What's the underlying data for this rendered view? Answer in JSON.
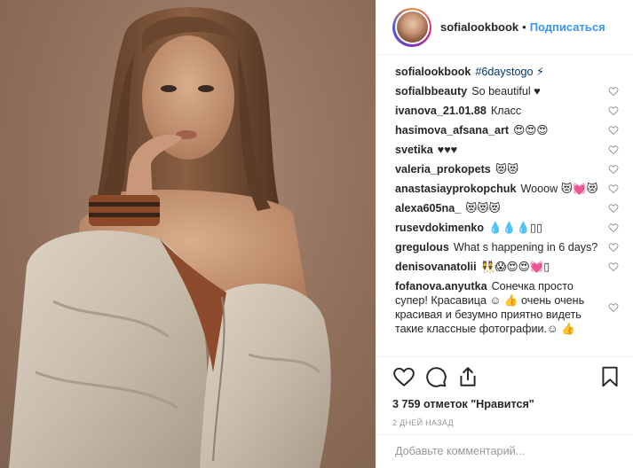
{
  "post": {
    "username": "sofialookbook",
    "follow_label": "Подписаться",
    "separator": "•",
    "caption": {
      "user": "sofialookbook",
      "hashtag": "#6daystogo",
      "suffix": "⚡"
    },
    "comments": [
      {
        "user": "sofialbbeauty",
        "text": "So beautiful ♥"
      },
      {
        "user": "ivanova_21.01.88",
        "text": "Класс"
      },
      {
        "user": "hasimova_afsana_art",
        "text": "😍😍😍"
      },
      {
        "user": "svetika",
        "text": "♥♥♥"
      },
      {
        "user": "valeria_prokopets",
        "text": "😻😻"
      },
      {
        "user": "anastasiayprokopchuk",
        "text": "Wooow 😻💓😻"
      },
      {
        "user": "alexa605na_",
        "text": "😻😻😻"
      },
      {
        "user": "rusevdokimenko",
        "text": "💧💧💧▯▯"
      },
      {
        "user": "gregulous",
        "text": "What s happening in 6 days?"
      },
      {
        "user": "denisovanatolii",
        "text": "👯😱😍😍💓▯"
      },
      {
        "user": "fofanova.anyutka",
        "text": "Сонечка просто супер! Красавица ☺ 👍 очень очень красивая и безумно приятно видеть такие классные фотографии.☺ 👍"
      }
    ],
    "likes": "3 759 отметок \"Нравится\"",
    "date": "2 ДНЕЙ НАЗАД",
    "add_comment_placeholder": "Добавьте комментарий..."
  },
  "icons": {
    "like": "heart-icon",
    "comment": "comment-icon",
    "share": "share-icon",
    "save": "bookmark-icon",
    "comment_like": "heart-icon"
  },
  "colors": {
    "accent": "#3897f0",
    "hashtag": "#003569",
    "text": "#262626",
    "muted": "#999999",
    "border": "#efefef"
  }
}
